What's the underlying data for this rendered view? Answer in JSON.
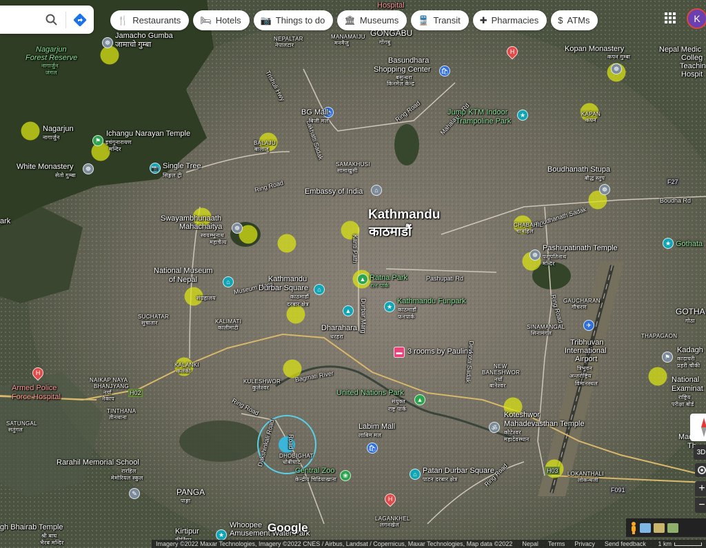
{
  "search": {
    "search_icon": "search-icon",
    "directions_icon": "directions-icon"
  },
  "chips": [
    {
      "icon": "restaurant-icon",
      "glyph": "🍴",
      "label": "Restaurants"
    },
    {
      "icon": "hotel-icon",
      "glyph": "🛏",
      "label": "Hotels"
    },
    {
      "icon": "camera-icon",
      "glyph": "📷",
      "label": "Things to do"
    },
    {
      "icon": "museum-icon",
      "glyph": "🏛",
      "label": "Museums"
    },
    {
      "icon": "transit-icon",
      "glyph": "🚆",
      "label": "Transit"
    },
    {
      "icon": "pharmacy-icon",
      "glyph": "✚",
      "label": "Pharmacies"
    },
    {
      "icon": "atm-icon",
      "glyph": "$",
      "label": "ATMs"
    }
  ],
  "account": {
    "initial": "K"
  },
  "labels": {
    "hospital_top": "Hospital",
    "jamacho": "Jamacho Gumba",
    "jamacho_np": "जामाचो गुम्बा",
    "nagarjun_forest": "Nagarjun",
    "nagarjun_forest2": "Forest Reserve",
    "nagarjun_forest_np": "नागार्जुन",
    "nagarjun_forest_np2": "जंगल",
    "nepaltar": "NEPALTAR",
    "nepaltar_np": "नेपालटार",
    "manamaiju": "MANAMAIJU",
    "manamaiju_np": "मनमैजु",
    "gongabu": "GONGABU",
    "gongabu_np": "गोंगबु",
    "basundhara": "Basundhara",
    "basundhara2": "Shopping Center",
    "basundhara_np": "बसुन्धरा",
    "basundhara_np2": "किनमेल केन्द्र",
    "kopan": "Kopan Monastery",
    "kopan_np": "कपन गुम्बा",
    "nepal_medical": "Nepal Medic",
    "nepal_medical2": "Colleg",
    "nepal_medical3": "Teachin",
    "nepal_medical4": "Hospit",
    "trishuli": "Trishuli Hwy",
    "lakhatti": "Lakhatti Sadak",
    "ring_road_n": "Ring Road",
    "bg_mall": "BG Mall",
    "bg_mall_np": "बिजी मल",
    "mahalaxmi": "Mahalaxmi Rd",
    "jump": "Jump KTM Indoor",
    "jump2": "Trampoline Park",
    "kapan": "KAPAN",
    "kapan_np": "कपन",
    "nagarjun": "Nagarjun",
    "nagarjun_np": "नागार्जुन",
    "ichangu": "Ichangu Narayan Temple",
    "ichangu_np": "इचंगुनारायण",
    "ichangu_np2": "मन्दिर",
    "balaju": "BALAJU",
    "balaju_np": "बालाजु",
    "white_monastery": "White Monastery",
    "white_monastery_np": "सेतो गुम्बा",
    "single_tree": "Single Tree",
    "single_tree_np": "सिङ्गल ट्री",
    "samakhusi": "SAMAKHUSI",
    "samakhusi_np": "सामाखुसी",
    "ring_road_w": "Ring Road",
    "embassy": "Embassy of India",
    "boudhanath": "Boudhanath Stupa",
    "boudhanath_np": "बौद्ध स्तुप",
    "f27": "F27",
    "boudha_rd": "Boudha Rd",
    "boudhanath_sadak": "Boudhanath Sadak",
    "kathmandu": "Kathmandu",
    "kathmandu_np": "काठमाडौं",
    "ark": "ark",
    "swayambhu": "Swayambhunaath",
    "swayambhu2": "Mahachaitya",
    "swayambhu_np": "स्वयम्भूनाथ",
    "swayambhu_np2": "महाचैत्य",
    "kanti_path": "Kanti Path",
    "chabahil": "CHABAHIL",
    "chabahil_np": "चाबहिल",
    "pashupati": "Pashupatinath Temple",
    "pashupati_np": "पशुपतिनाथ",
    "pashupati_np2": "मन्दिर",
    "gothata": "Gothata",
    "pashupati_rd": "Pashupati Rd",
    "national_museum": "National Museum",
    "national_museum2": "of Nepal",
    "national_museum_np": "संग्रहालय",
    "museum_marg": "Museum Marg",
    "ktm_durbar": "Kathmandu",
    "ktm_durbar2": "Durbar Square",
    "ktm_durbar_np": "काठमाडौं",
    "ktm_durbar_np2": "दरबार क्षेत्र",
    "ratna_park": "Ratna Park",
    "ratna_park_np": "रत्न पार्क",
    "ktm_funpark": "Kathmandu Funpark",
    "ktm_funpark_np": "काठमाडौं",
    "ktm_funpark_np2": "फनपार्क",
    "ring_road_e": "Ring Road",
    "gaucharan": "GAUCHARAN",
    "gaucharan_np": "गौचरण",
    "gotha": "GOTHA",
    "gotha_np": "गोठा",
    "suchatar": "SUCHATAR",
    "suchatar_np": "सुचातार",
    "kalimati": "KALIMATI",
    "kalimati_np": "कालीमाटी",
    "durbar_marg": "Durbar Marg",
    "dharahara": "Dharahara",
    "dharahara_np": "धरहरा",
    "sinamangal": "SINAMANGAL",
    "sinamangal_np": "सिनामंगल",
    "tribhuvan": "Tribhuvan",
    "tribhuvan2": "International",
    "tribhuvan3": "Airport",
    "tribhuvan_np": "त्रिभुवन",
    "tribhuvan_np2": "अन्तर्राष्ट्रिय",
    "tribhuvan_np3": "विमानस्थल",
    "thapagaon": "THAPAGAON",
    "kadagh": "Kadagh",
    "kadagh_np": "कादाघरी",
    "kadagh_np2": "प्रहरी चौकी",
    "national_exam": "National",
    "national_exam2": "Examinat",
    "national_exam_np": "राष्ट्रिय",
    "national_exam_np2": "परीक्षा बोर्ड",
    "kalanki": "KALANKI",
    "kalanki_np": "कलंकी",
    "bagmati": "Bagmati River",
    "three_rooms": "3 rooms by Pauline",
    "new_baneshwor": "NEW",
    "new_baneshwor2": "BANESHWOR",
    "new_baneshwor_np": "नयाँ",
    "new_baneshwor_np2": "बानेश्वर",
    "devkota": "Devkota Sadak",
    "naikap": "NAIKAP NAYA",
    "naikap2": "BHANJYANG",
    "naikap_np": "नयाँ",
    "naikap_np2": "नैकाप",
    "kuleshwor": "KULESHWOR",
    "kuleshwor_np": "कुलेश्वर",
    "armed_police": "Armed Police",
    "armed_police2": "Force Hospital",
    "h02": "H02",
    "united_nations": "United Nations Park",
    "united_nations_np": "संयुक्त",
    "united_nations_np2": "राष्ट्र पार्क",
    "tinthana": "TINTHANA",
    "tinthana_np": "तीनथाना",
    "ring_road_sw": "Ring Road",
    "satungal": "SATUNGAL",
    "satungal_np": "सतुंगल",
    "labim": "Labim Mall",
    "labim_np": "लाबिम मल",
    "koteshwor": "Koteshwor",
    "koteshwor2": "Mahadevasthan Temple",
    "koteshwor_np": "कोटेश्वर",
    "koteshwor_np2": "महादेवस्थान",
    "dakshinkali": "Dakshinkali Road",
    "dobighat": "DHOBIGHAT",
    "dobighat_np": "धोबीघाट",
    "jhamsikhel_road": "Road",
    "rarahil": "Rarahil Memorial School",
    "rarahil_np": "रारहिल",
    "rarahil_np2": "मेमोरियल स्कुल",
    "central_zoo": "Central Zoo",
    "central_zoo_np": "केन्द्रीय चिडियाखाना",
    "patan": "Patan Durbar Square",
    "patan_np": "पाटन दरबार क्षेत्र",
    "h03": "H03",
    "lokanthali": "LOKANTHALI",
    "lokanthali_np": "लोकन्थली",
    "f091": "F091",
    "madh": "Madh",
    "madh2": "Th",
    "panga": "PANGA",
    "panga_np": "पाङ्गा",
    "ring_road_s": "Ring Road",
    "laganakhel": "LAGANKHEL",
    "laganakhel_np": "लगनखेल",
    "bhairab": "gh Bhairab Temple",
    "bhairab_np": "श्री बाघ",
    "bhairab_np2": "भैरब मन्दिर",
    "kirtipur": "Kirtipur",
    "kirtipur_np": "कीर्तिपुर",
    "whoopee": "Whoopee",
    "whoopee2": "Amusement Water Park"
  },
  "logo": "Google",
  "footer": {
    "attribution": "Imagery ©2022 Maxar Technologies, Imagery ©2022 CNES / Airbus, Landsat / Copernicus, Maxar Technologies, Map data ©2022",
    "links": [
      "Nepal",
      "Terms",
      "Privacy",
      "Send feedback"
    ],
    "scale": "1 km"
  },
  "controls": {
    "tilt": "3D",
    "zoom_in": "+",
    "zoom_out": "−"
  },
  "colors": {
    "highlight": "#dce614",
    "location": "#3bb6d8",
    "map_dark": "#3d4636"
  }
}
